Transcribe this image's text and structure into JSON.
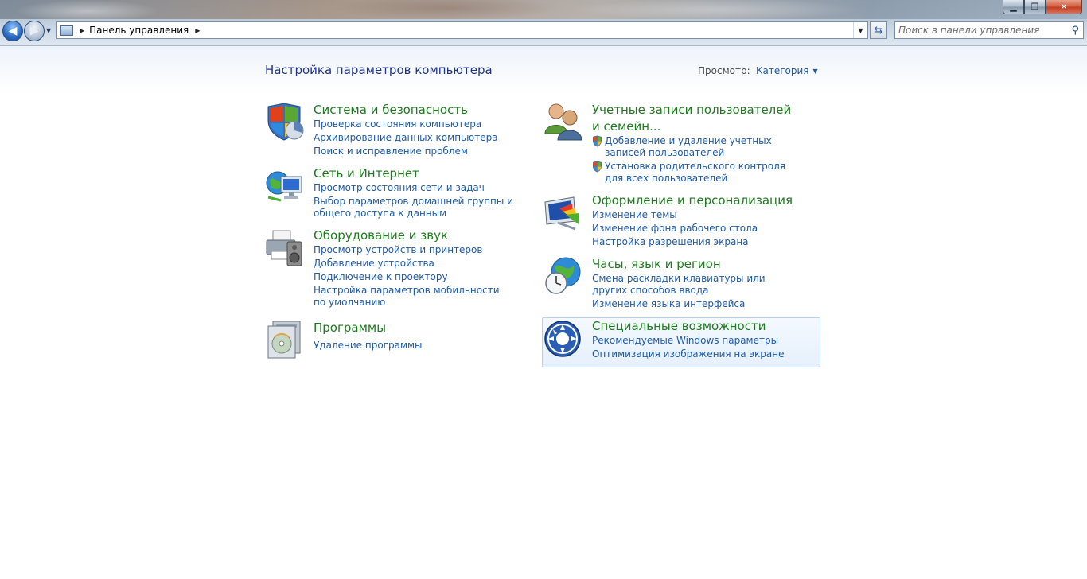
{
  "window": {
    "minimize_label": "▁",
    "maximize_label": "❐",
    "close_label": "✕"
  },
  "navigation": {
    "back_glyph": "◀",
    "forward_glyph": "▶",
    "dropdown_glyph": "▼",
    "breadcrumb": {
      "items": [
        "Панель управления"
      ],
      "arrow": "▶"
    },
    "refresh_glyph": "⇆"
  },
  "search": {
    "placeholder": "Поиск в панели управления",
    "icon": "search-icon",
    "icon_glyph": "⚲"
  },
  "header": {
    "title": "Настройка параметров компьютера",
    "view_label": "Просмотр:",
    "view_value": "Категория",
    "view_caret": "▼"
  },
  "categories": [
    {
      "title": "Система и безопасность",
      "icon": "shield-icon",
      "links": [
        "Проверка состояния компьютера",
        "Архивирование данных компьютера",
        "Поиск и исправление проблем"
      ]
    },
    {
      "title": "Сеть и Интернет",
      "icon": "network-globe-icon",
      "links": [
        "Просмотр состояния сети и задач",
        "Выбор параметров домашней группы и общего доступа к данным"
      ]
    },
    {
      "title": "Оборудование и звук",
      "icon": "printer-speaker-icon",
      "links": [
        "Просмотр устройств и принтеров",
        "Добавление устройства",
        "Подключение к проектору",
        "Настройка параметров мобильности по умолчанию"
      ]
    },
    {
      "title": "Программы",
      "icon": "programs-disc-icon",
      "links": [
        "Удаление программы"
      ]
    },
    {
      "title": "Учетные записи пользователей и семейн...",
      "icon": "users-icon",
      "links": [
        "Добавление и удаление учетных записей пользователей",
        "Установка родительского контроля для всех пользователей"
      ]
    },
    {
      "title": "Оформление и персонализация",
      "icon": "monitor-palette-icon",
      "links": [
        "Изменение темы",
        "Изменение фона рабочего стола",
        "Настройка разрешения экрана"
      ]
    },
    {
      "title": "Часы, язык и регион",
      "icon": "clock-globe-icon",
      "links": [
        "Смена раскладки клавиатуры или других способов ввода",
        "Изменение языка интерфейса"
      ]
    },
    {
      "title": "Специальные возможности",
      "icon": "accessibility-icon",
      "links": [
        "Рекомендуемые Windows параметры",
        "Оптимизация изображения на экране"
      ]
    }
  ],
  "colors": {
    "category_title": "#1e7a1e",
    "link": "#1e5aa8",
    "page_title": "#1e3287"
  }
}
